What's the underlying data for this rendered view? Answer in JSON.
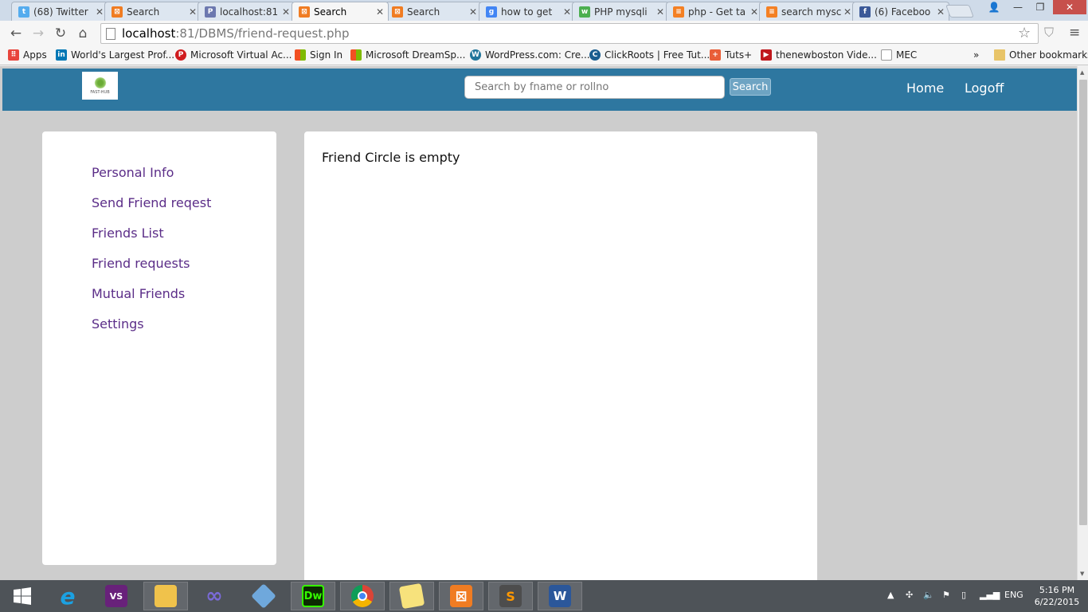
{
  "browser": {
    "tabs": [
      {
        "title": "(68) Twitter",
        "icon": "twitter-icon",
        "color": "#55acee"
      },
      {
        "title": "Search",
        "icon": "xampp-icon",
        "color": "#f07c22"
      },
      {
        "title": "localhost:81",
        "icon": "phpmyadmin-icon",
        "color": "#6c78af"
      },
      {
        "title": "Search",
        "icon": "xampp-icon",
        "color": "#f07c22"
      },
      {
        "title": "Search",
        "icon": "xampp-icon",
        "color": "#f07c22"
      },
      {
        "title": "how to get",
        "icon": "google-icon",
        "color": "#4285f4"
      },
      {
        "title": "PHP mysqli",
        "icon": "w3schools-icon",
        "color": "#4caf50"
      },
      {
        "title": "php - Get ta",
        "icon": "stackoverflow-icon",
        "color": "#f48024"
      },
      {
        "title": "search mysc",
        "icon": "stackoverflow-icon",
        "color": "#f48024"
      },
      {
        "title": "(6) Faceboo",
        "icon": "facebook-icon",
        "color": "#3b5998"
      }
    ],
    "active_tab_index": 3,
    "address": {
      "host": "localhost",
      "path": ":81/DBMS/friend-request.php"
    },
    "bookmarks": [
      {
        "label": "Apps",
        "icon": "apps-grid-icon",
        "color": "#e8453c"
      },
      {
        "label": "World's Largest Prof...",
        "icon": "linkedin-icon",
        "color": "#0077b5"
      },
      {
        "label": "Microsoft Virtual Ac...",
        "icon": "mva-icon",
        "color": "#d01c1f"
      },
      {
        "label": "Sign In",
        "icon": "windows-icon",
        "color": "#f25022"
      },
      {
        "label": "Microsoft DreamSp...",
        "icon": "windows-icon",
        "color": "#f25022"
      },
      {
        "label": "WordPress.com: Cre...",
        "icon": "wordpress-icon",
        "color": "#21759b"
      },
      {
        "label": "ClickRoots | Free Tut...",
        "icon": "clickroots-icon",
        "color": "#1a5d8f"
      },
      {
        "label": "Tuts+",
        "icon": "tutsplus-icon",
        "color": "#e95e38"
      },
      {
        "label": "thenewboston Vide...",
        "icon": "thenewboston-icon",
        "color": "#c0171c"
      },
      {
        "label": "MEC",
        "icon": "page-icon",
        "color": "#ffffff"
      }
    ],
    "bookmarks_overflow": "»",
    "other_bookmarks": "Other bookmarks"
  },
  "site": {
    "logo_text": "FAST-HUB",
    "search_placeholder": "Search by fname or rollno",
    "search_button": "Search",
    "nav_home": "Home",
    "nav_logoff": "Logoff",
    "header_color": "#2e77a0"
  },
  "sidebar": {
    "items": [
      {
        "label": "Personal Info"
      },
      {
        "label": "Send Friend reqest"
      },
      {
        "label": "Friends List"
      },
      {
        "label": "Friend requests"
      },
      {
        "label": "Mutual Friends"
      },
      {
        "label": "Settings"
      }
    ],
    "link_color": "#5b2d88"
  },
  "content": {
    "message": "Friend Circle is empty"
  },
  "taskbar": {
    "apps": [
      {
        "name": "internet-explorer",
        "label": "e",
        "color": "#1ba1e2"
      },
      {
        "name": "visual-studio",
        "label": "VS",
        "color": "#68217a"
      },
      {
        "name": "file-explorer",
        "label": "",
        "color": "#f0c24b"
      },
      {
        "name": "infinity-app",
        "label": "∞",
        "color": "#3a3a8c"
      },
      {
        "name": "virtualbox",
        "label": "",
        "color": "#6fa8dc"
      },
      {
        "name": "dreamweaver",
        "label": "Dw",
        "color": "#35fa00"
      },
      {
        "name": "chrome",
        "label": "",
        "color": "#db4437"
      },
      {
        "name": "notes",
        "label": "",
        "color": "#f7e27c"
      },
      {
        "name": "xampp",
        "label": "",
        "color": "#f07c22"
      },
      {
        "name": "sublime-text",
        "label": "S",
        "color": "#4d4d4d"
      },
      {
        "name": "word",
        "label": "W",
        "color": "#2b579a"
      }
    ],
    "language": "ENG",
    "time": "5:16 PM",
    "date": "6/22/2015"
  }
}
